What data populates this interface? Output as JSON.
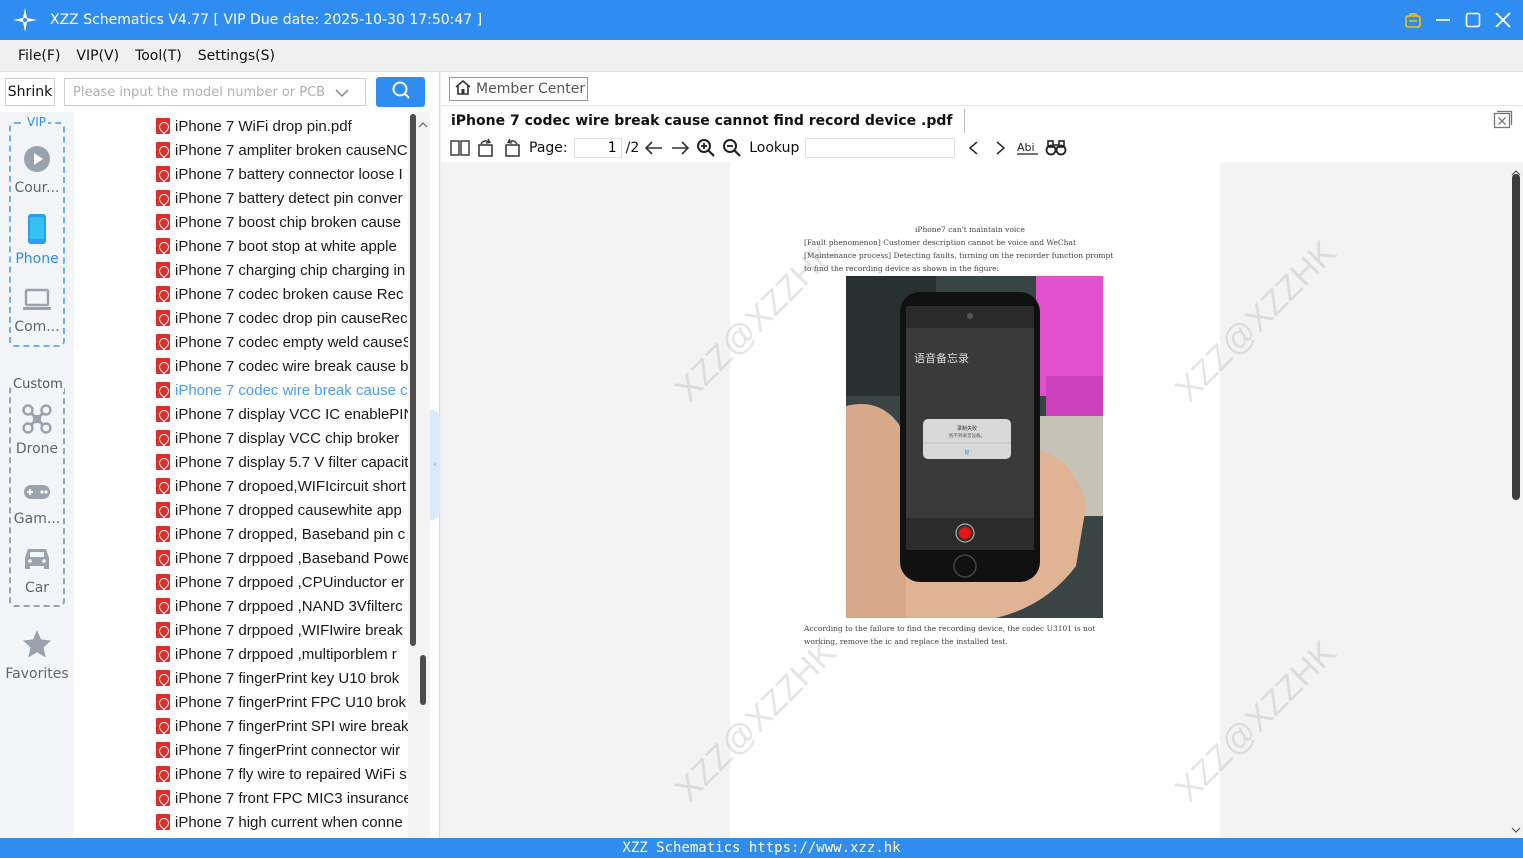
{
  "window": {
    "title": "XZZ Schematics V4.77 [ VIP Due date: 2025-10-30 17:50:47 ]"
  },
  "menu": [
    "File(F)",
    "VIP(V)",
    "Tool(T)",
    "Settings(S)"
  ],
  "search": {
    "shrink_label": "Shrink",
    "placeholder": "Please input the model number or PCB"
  },
  "categories": {
    "vip_label": "VIP",
    "custom_label": "Custom",
    "items": [
      {
        "label": "Cour..."
      },
      {
        "label": "Phone"
      },
      {
        "label": "Com..."
      },
      {
        "label": "Drone"
      },
      {
        "label": "Gam..."
      },
      {
        "label": "Car"
      },
      {
        "label": "Favorites"
      }
    ]
  },
  "files": [
    "iPhone 7 WiFi drop pin.pdf",
    "iPhone 7 ampliter broken causeNC",
    "iPhone 7 battery connector loose I",
    "iPhone 7 battery detect pin conver",
    "iPhone 7 boost chip  broken cause",
    "iPhone 7 boot stop at white apple",
    "iPhone 7 charging chip charging in",
    "iPhone 7 codec  broken cause Rec",
    "iPhone 7 codec drop pin causeRec",
    "iPhone 7 codec empty weld causeS",
    "iPhone 7 codec wire break cause b",
    "iPhone 7 codec wire break cause c",
    "iPhone 7 display  VCC IC enablePIN",
    "iPhone 7 display  VCC chip  broker",
    "iPhone 7 display 5.7 V filter capacit",
    "iPhone 7 dropoed,WIFIcircuit short",
    "iPhone 7 dropped causewhite app",
    "iPhone 7 dropped, Baseband pin c",
    "iPhone 7 drppoed ,Baseband Powe",
    "iPhone 7 drppoed ,CPUinductor er",
    "iPhone 7 drppoed ,NAND 3Vfilterc",
    "iPhone 7 drppoed ,WIFIwire break",
    "iPhone 7 drppoed ,multiporblem r",
    "iPhone 7 fingerPrint  key U10 brok",
    "iPhone 7 fingerPrint FPC U10 brok",
    "iPhone 7 fingerPrint SPI wire break",
    "iPhone 7 fingerPrint connector wir",
    "iPhone 7 fly wire to repaired WiFi s",
    "iPhone 7 front FPC MIC3 insurance",
    "iPhone 7 high current when conne"
  ],
  "viewer": {
    "member_center": "Member Center",
    "doc_title": "iPhone 7 codec wire break cause cannot find record device .pdf",
    "page_label": "Page:",
    "page_current": "1",
    "page_total": "/2",
    "lookup_label": "Lookup",
    "doc_lines": [
      "iPhone7 can't maintain voice",
      "[Fault phenomenon] Customer description cannot be voice and WeChat",
      "[Maintenance process] Detecting faults, turning on the recorder function prompt",
      "to find the recording device as shown in the figure:",
      "According to the failure to find the recording device, the codec U3101 is not",
      "working, remove the ic and replace the installed test."
    ],
    "photo_text": {
      "app_title": "语音备忘录",
      "alert_title": "录制失败",
      "alert_body": "找不到录音设备。",
      "alert_button": "好"
    },
    "watermark": "XZZ@XZZHK"
  },
  "status": "XZZ Schematics https://www.xzz.hk",
  "colors": {
    "accent": "#2f8cf0",
    "pdf_red": "#d9302c",
    "selected_text": "#4a9ef5"
  }
}
